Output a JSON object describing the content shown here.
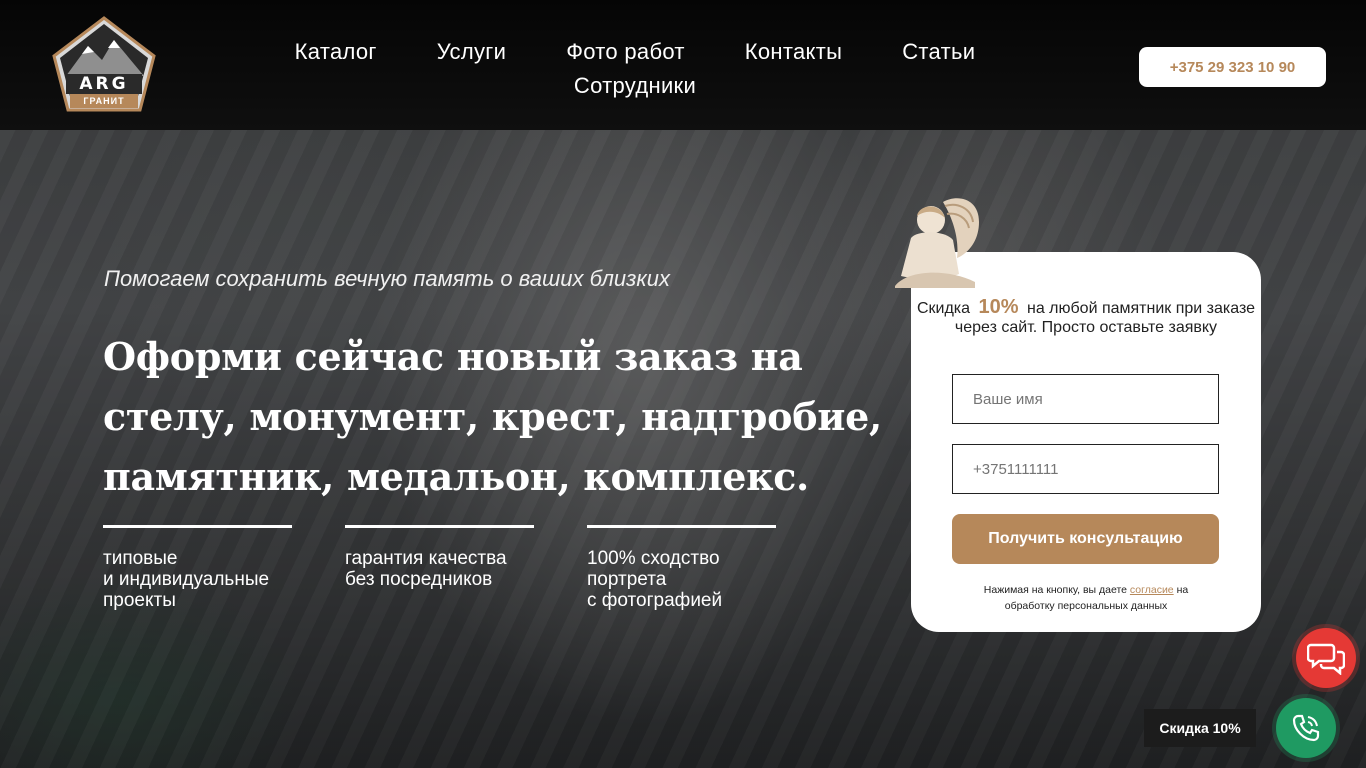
{
  "header": {
    "logo_text": "ARG",
    "logo_subtext": "ГРАНИТ",
    "nav": [
      "Каталог",
      "Услуги",
      "Фото работ",
      "Контакты",
      "Статьи",
      "Сотрудники"
    ],
    "phone": "+375 29 323 10 90"
  },
  "hero": {
    "tagline": "Помогаем сохранить вечную память о ваших близких",
    "headline": "Оформи сейчас новый заказ на стелу, монумент, крест, надгробие, памятник, медальон, комплекс.",
    "features": [
      "типовые\nи индивидуальные\nпроекты",
      "гарантия качества\nбез посредников",
      "100% сходство\nпортрета\nс фотографией"
    ]
  },
  "form": {
    "promo_before": "Скидка",
    "promo_percent": "10%",
    "promo_after": "на любой памятник при заказе через сайт. Просто оставьте заявку",
    "name_placeholder": "Ваше имя",
    "phone_placeholder": "+3751111111",
    "submit_label": "Получить консультацию",
    "consent_before": "Нажимая на кнопку, вы даете",
    "consent_link": "согласие",
    "consent_after": "на обработку персональных данных"
  },
  "widgets": {
    "discount_label": "Скидка 10%"
  },
  "colors": {
    "accent": "#b6885a",
    "chat": "#e53935",
    "call": "#1f9a62",
    "header_bg": "#050505"
  },
  "icons": [
    "logo-mountain-icon",
    "angel-icon",
    "chat-bubbles-icon",
    "phone-call-icon"
  ]
}
